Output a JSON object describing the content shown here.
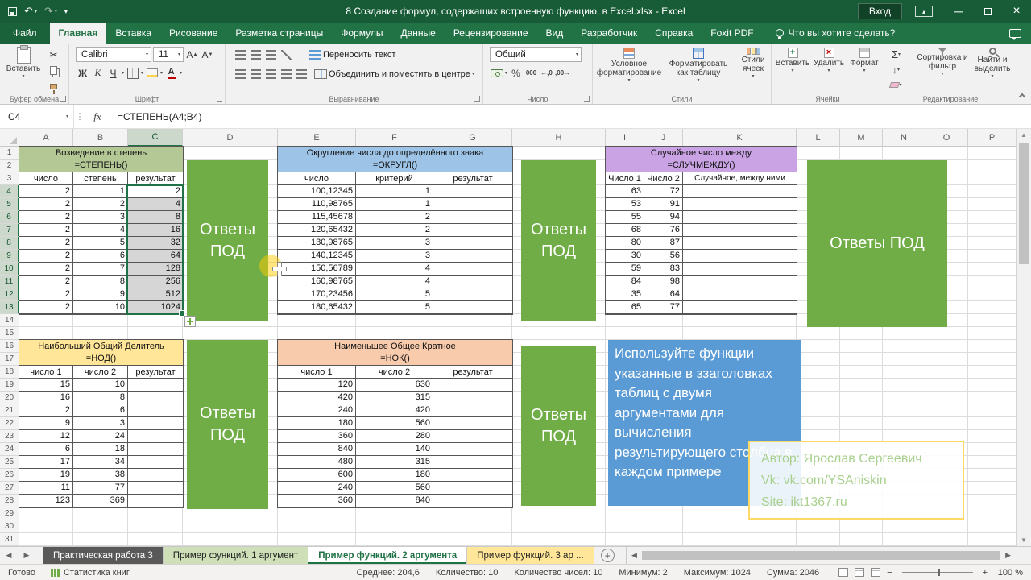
{
  "colors": {
    "accent_green": "#217346",
    "titlebar_green": "#185c37",
    "answers_box_green": "#70ad47",
    "instruction_blue": "#5b9bd5",
    "author_border_yellow": "#ffd966",
    "author_text_green": "#a9d08e",
    "power_header_green": "#b4c896",
    "round_header_blue": "#9dc3e6",
    "random_header_purple": "#c9a3e3",
    "gcd_header_yellow": "#ffe699",
    "lcm_header_orange": "#f8cbad"
  },
  "title_bar": {
    "title": "8 Создание формул, содержащих встроенную функцию, в Excel.xlsx - Excel",
    "sign_in": "Вход"
  },
  "ribbon_tabs": [
    "Файл",
    "Главная",
    "Вставка",
    "Рисование",
    "Разметка страницы",
    "Формулы",
    "Данные",
    "Рецензирование",
    "Вид",
    "Разработчик",
    "Справка",
    "Foxit PDF"
  ],
  "search_hint": "Что вы хотите сделать?",
  "ribbon": {
    "groups": [
      "Буфер обмена",
      "Шрифт",
      "Выравнивание",
      "Число",
      "Стили",
      "Ячейки",
      "Редактирование"
    ],
    "clipboard": {
      "paste": "Вставить"
    },
    "font": {
      "name": "Calibri",
      "size": "11",
      "bold": "Ж",
      "italic": "К",
      "underline": "Ч",
      "grow": "А",
      "shrink": "А"
    },
    "alignment": {
      "wrap_text": "Переносить текст",
      "merge_center": "Объединить и поместить в центре"
    },
    "number": {
      "format": "Общий",
      "thousands": "000"
    },
    "styles": {
      "conditional": "Условное форматирование",
      "format_table": "Форматировать как таблицу",
      "cell_styles": "Стили ячеек"
    },
    "cells": {
      "insert": "Вставить",
      "delete": "Удалить",
      "format": "Формат"
    },
    "editing": {
      "sort": "Сортировка и фильтр",
      "find": "Найти и выделить"
    }
  },
  "formula_bar": {
    "cell_ref": "C4",
    "fx": "fx",
    "formula": "=СТЕПЕНЬ(A4;B4)"
  },
  "grid": {
    "columns": [
      "A",
      "B",
      "C",
      "D",
      "E",
      "F",
      "G",
      "H",
      "I",
      "J",
      "K",
      "L",
      "M",
      "N",
      "O",
      "P"
    ],
    "row_numbers": [
      "1",
      "2",
      "3",
      "4",
      "5",
      "6",
      "7",
      "8",
      "9",
      "10",
      "11",
      "12",
      "13",
      "14",
      "15",
      "16",
      "17",
      "18",
      "19",
      "20",
      "21",
      "22",
      "23",
      "24",
      "25",
      "26",
      "27",
      "28",
      "29",
      "30",
      "31"
    ]
  },
  "tables": {
    "power": {
      "title": "Возведение в степень",
      "func": "=СТЕПЕНЬ()",
      "headers": [
        "число",
        "степень",
        "результат"
      ],
      "rows": [
        [
          "2",
          "1",
          "2"
        ],
        [
          "2",
          "2",
          "4"
        ],
        [
          "2",
          "3",
          "8"
        ],
        [
          "2",
          "4",
          "16"
        ],
        [
          "2",
          "5",
          "32"
        ],
        [
          "2",
          "6",
          "64"
        ],
        [
          "2",
          "7",
          "128"
        ],
        [
          "2",
          "8",
          "256"
        ],
        [
          "2",
          "9",
          "512"
        ],
        [
          "2",
          "10",
          "1024"
        ]
      ]
    },
    "round": {
      "title": "Округление числа до определённого знака",
      "func": "=ОКРУГЛ()",
      "headers": [
        "число",
        "критерий",
        "результат"
      ],
      "rows": [
        [
          "100,12345",
          "1",
          ""
        ],
        [
          "110,98765",
          "1",
          ""
        ],
        [
          "115,45678",
          "2",
          ""
        ],
        [
          "120,65432",
          "2",
          ""
        ],
        [
          "130,98765",
          "3",
          ""
        ],
        [
          "140,12345",
          "3",
          ""
        ],
        [
          "150,56789",
          "4",
          ""
        ],
        [
          "160,98765",
          "4",
          ""
        ],
        [
          "170,23456",
          "5",
          ""
        ],
        [
          "180,65432",
          "5",
          ""
        ]
      ]
    },
    "random": {
      "title": "Случайное число между",
      "func": "=СЛУЧМЕЖДУ()",
      "headers": [
        "Число 1",
        "Число 2",
        "Случайное, между ними"
      ],
      "rows": [
        [
          "63",
          "72",
          ""
        ],
        [
          "53",
          "91",
          ""
        ],
        [
          "55",
          "94",
          ""
        ],
        [
          "68",
          "76",
          ""
        ],
        [
          "80",
          "87",
          ""
        ],
        [
          "30",
          "56",
          ""
        ],
        [
          "59",
          "83",
          ""
        ],
        [
          "84",
          "98",
          ""
        ],
        [
          "35",
          "64",
          ""
        ],
        [
          "65",
          "77",
          ""
        ]
      ]
    },
    "gcd": {
      "title": "Наибольший Общий Делитель",
      "func": "=НОД()",
      "headers": [
        "число 1",
        "число 2",
        "результат"
      ],
      "rows": [
        [
          "15",
          "10",
          ""
        ],
        [
          "16",
          "8",
          ""
        ],
        [
          "2",
          "6",
          ""
        ],
        [
          "9",
          "3",
          ""
        ],
        [
          "12",
          "24",
          ""
        ],
        [
          "6",
          "18",
          ""
        ],
        [
          "17",
          "34",
          ""
        ],
        [
          "19",
          "38",
          ""
        ],
        [
          "11",
          "77",
          ""
        ],
        [
          "123",
          "369",
          ""
        ]
      ]
    },
    "lcm": {
      "title": "Наименьшее Общее Кратное",
      "func": "=НОК()",
      "headers": [
        "число 1",
        "число 2",
        "результат"
      ],
      "rows": [
        [
          "120",
          "630",
          ""
        ],
        [
          "420",
          "315",
          ""
        ],
        [
          "240",
          "420",
          ""
        ],
        [
          "180",
          "560",
          ""
        ],
        [
          "360",
          "280",
          ""
        ],
        [
          "840",
          "140",
          ""
        ],
        [
          "480",
          "315",
          ""
        ],
        [
          "600",
          "180",
          ""
        ],
        [
          "240",
          "560",
          ""
        ],
        [
          "360",
          "840",
          ""
        ]
      ]
    }
  },
  "shapes": {
    "answers_label": "Ответы ПОД",
    "instruction": "Используйте функции указанные в ззаголовках таблиц с двумя аргументами для вычисления результирующего столбца в каждом примере",
    "author_line1": "Автор: Ярослав Сергеевич",
    "author_line2": "Vk: vk.com/YSAniskin",
    "author_line3": "Site: ikt1367.ru"
  },
  "sheet_tabs": {
    "tabs": [
      "Практическая работа 3",
      "Пример функций. 1 аргумент",
      "Пример функций. 2 аргумента",
      "Пример функций. 3 ар ..."
    ],
    "active_index": 2
  },
  "status_bar": {
    "mode": "Готово",
    "left_info": "Статистика книг",
    "stats": [
      "Среднее: 204,6",
      "Количество: 10",
      "Количество чисел: 10",
      "Минимум: 2",
      "Максимум: 1024",
      "Сумма: 2046"
    ],
    "zoom": "100 %"
  }
}
